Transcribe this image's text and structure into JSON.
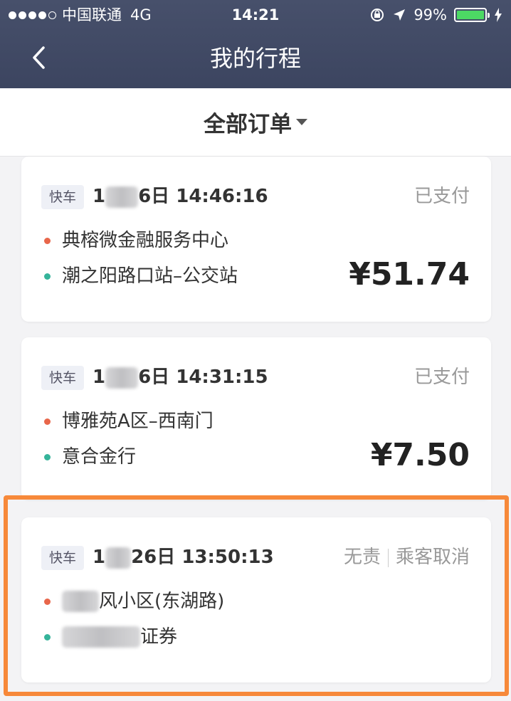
{
  "status_bar": {
    "carrier": "中国联通",
    "network": "4G",
    "time": "14:21",
    "battery": "99%",
    "battery_level": 0.99
  },
  "nav": {
    "title": "我的行程",
    "back_icon": "chevron-left-icon"
  },
  "filter": {
    "label": "全部订单",
    "caret_icon": "caret-down-icon"
  },
  "orders": [
    {
      "tag": "快车",
      "date_prefix": "1",
      "date_suffix": "6日 14:46:16",
      "status": "已支付",
      "origin": "典榕微金融服务中心",
      "destination": "潮之阳路口站–公交站",
      "price": "¥51.74"
    },
    {
      "tag": "快车",
      "date_prefix": "1",
      "date_suffix": "6日 14:31:15",
      "status": "已支付",
      "origin": "博雅苑A区–西南门",
      "destination": "意合金行",
      "price": "¥7.50"
    },
    {
      "tag": "快车",
      "date_prefix": "1",
      "date_suffix": "26日 13:50:13",
      "status_a": "无责",
      "status_b": "乘客取消",
      "origin_suffix": "风小区(东湖路)",
      "destination_suffix": "证券"
    }
  ],
  "colors": {
    "header": "#3f4862",
    "origin_dot": "#e8664a",
    "destination_dot": "#35b49a",
    "highlight": "#f7893a",
    "battery": "#4cd964"
  }
}
